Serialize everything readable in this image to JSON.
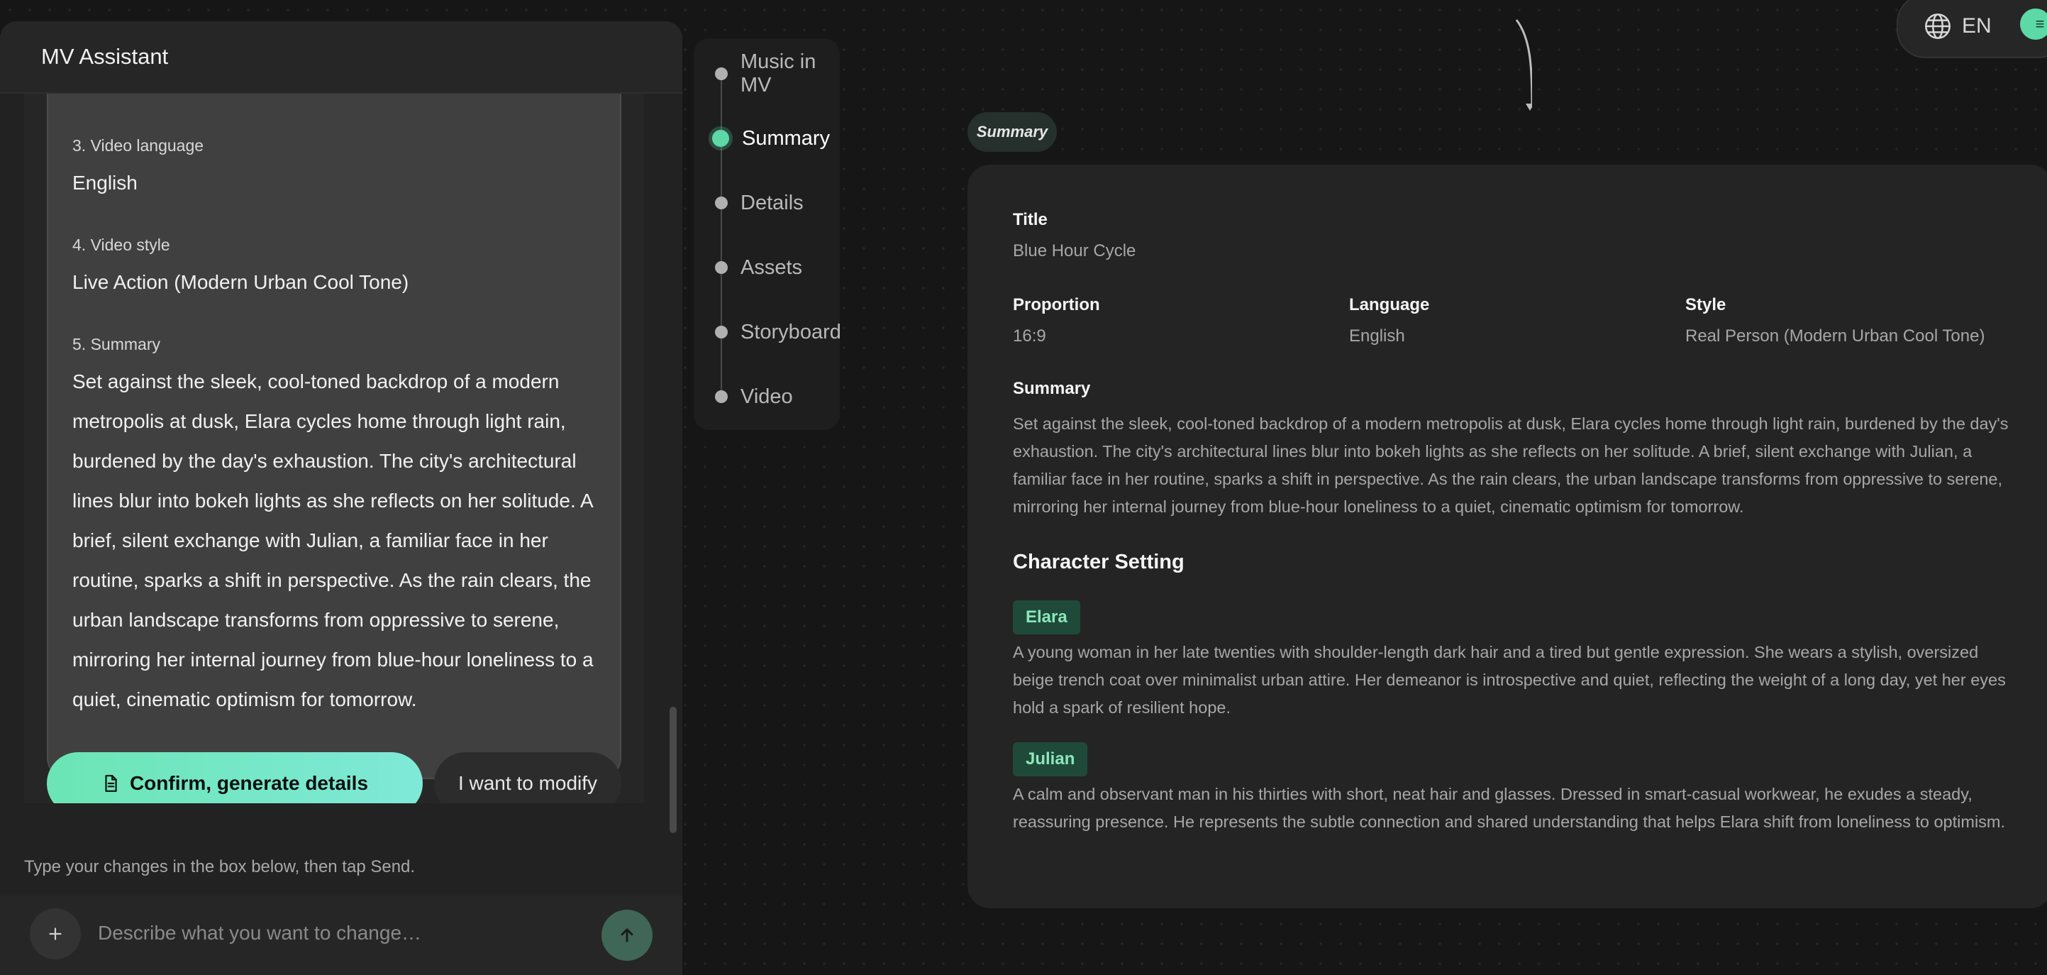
{
  "assistant": {
    "title": "MV Assistant",
    "fields": [
      {
        "label": "3. Video language",
        "value": "English"
      },
      {
        "label": "4. Video style",
        "value": "Live Action (Modern Urban Cool Tone)"
      },
      {
        "label": "5. Summary",
        "value": "Set against the sleek, cool-toned backdrop of a modern metropolis at dusk, Elara cycles home through light rain, burdened by the day's exhaustion. The city's architectural lines blur into bokeh lights as she reflects on her solitude. A brief, silent exchange with Julian, a familiar face in her routine, sparks a shift in perspective. As the rain clears, the urban landscape transforms from oppressive to serene, mirroring her internal journey from blue-hour loneliness to a quiet, cinematic optimism for tomorrow."
      }
    ],
    "confirm_label": "Confirm, generate details",
    "modify_label": "I want to modify",
    "hint": "Type your changes in the box below, then tap Send.",
    "input_placeholder": "Describe what you want to change…"
  },
  "steps": [
    {
      "label": "Music in MV",
      "active": false
    },
    {
      "label": "Summary",
      "active": true
    },
    {
      "label": "Details",
      "active": false
    },
    {
      "label": "Assets",
      "active": false
    },
    {
      "label": "Storyboard",
      "active": false
    },
    {
      "label": "Video",
      "active": false
    }
  ],
  "summary_node": {
    "tag": "Summary",
    "title_label": "Title",
    "title_value": "Blue Hour Cycle",
    "proportion_label": "Proportion",
    "proportion_value": "16:9",
    "language_label": "Language",
    "language_value": "English",
    "style_label": "Style",
    "style_value": "Real Person (Modern Urban Cool Tone)",
    "summary_label": "Summary",
    "summary_value": "Set against the sleek, cool-toned backdrop of a modern metropolis at dusk, Elara cycles home through light rain, burdened by the day's exhaustion. The city's architectural lines blur into bokeh lights as she reflects on her solitude. A brief, silent exchange with Julian, a familiar face in her routine, sparks a shift in perspective. As the rain clears, the urban landscape transforms from oppressive to serene, mirroring her internal journey from blue-hour loneliness to a quiet, cinematic optimism for tomorrow.",
    "character_heading": "Character Setting",
    "characters": [
      {
        "name": "Elara",
        "description": "A young woman in her late twenties with shoulder-length dark hair and a tired but gentle expression. She wears a stylish, oversized beige trench coat over minimalist urban attire. Her demeanor is introspective and quiet, reflecting the weight of a long day, yet her eyes hold a spark of resilient hope."
      },
      {
        "name": "Julian",
        "description": "A calm and observant man in his thirties with short, neat hair and glasses. Dressed in smart-casual workwear, he exudes a steady, reassuring presence. He represents the subtle connection and shared understanding that helps Elara shift from loneliness to optimism."
      }
    ]
  },
  "language_selector": {
    "label": "EN",
    "icon": "globe-icon"
  },
  "colors": {
    "accent": "#5cd9a6",
    "confirm_gradient_start": "#6be5b4",
    "confirm_gradient_end": "#7fe9d8",
    "badge_bg": "#1f4a3a",
    "badge_text": "#8ce6bc"
  }
}
